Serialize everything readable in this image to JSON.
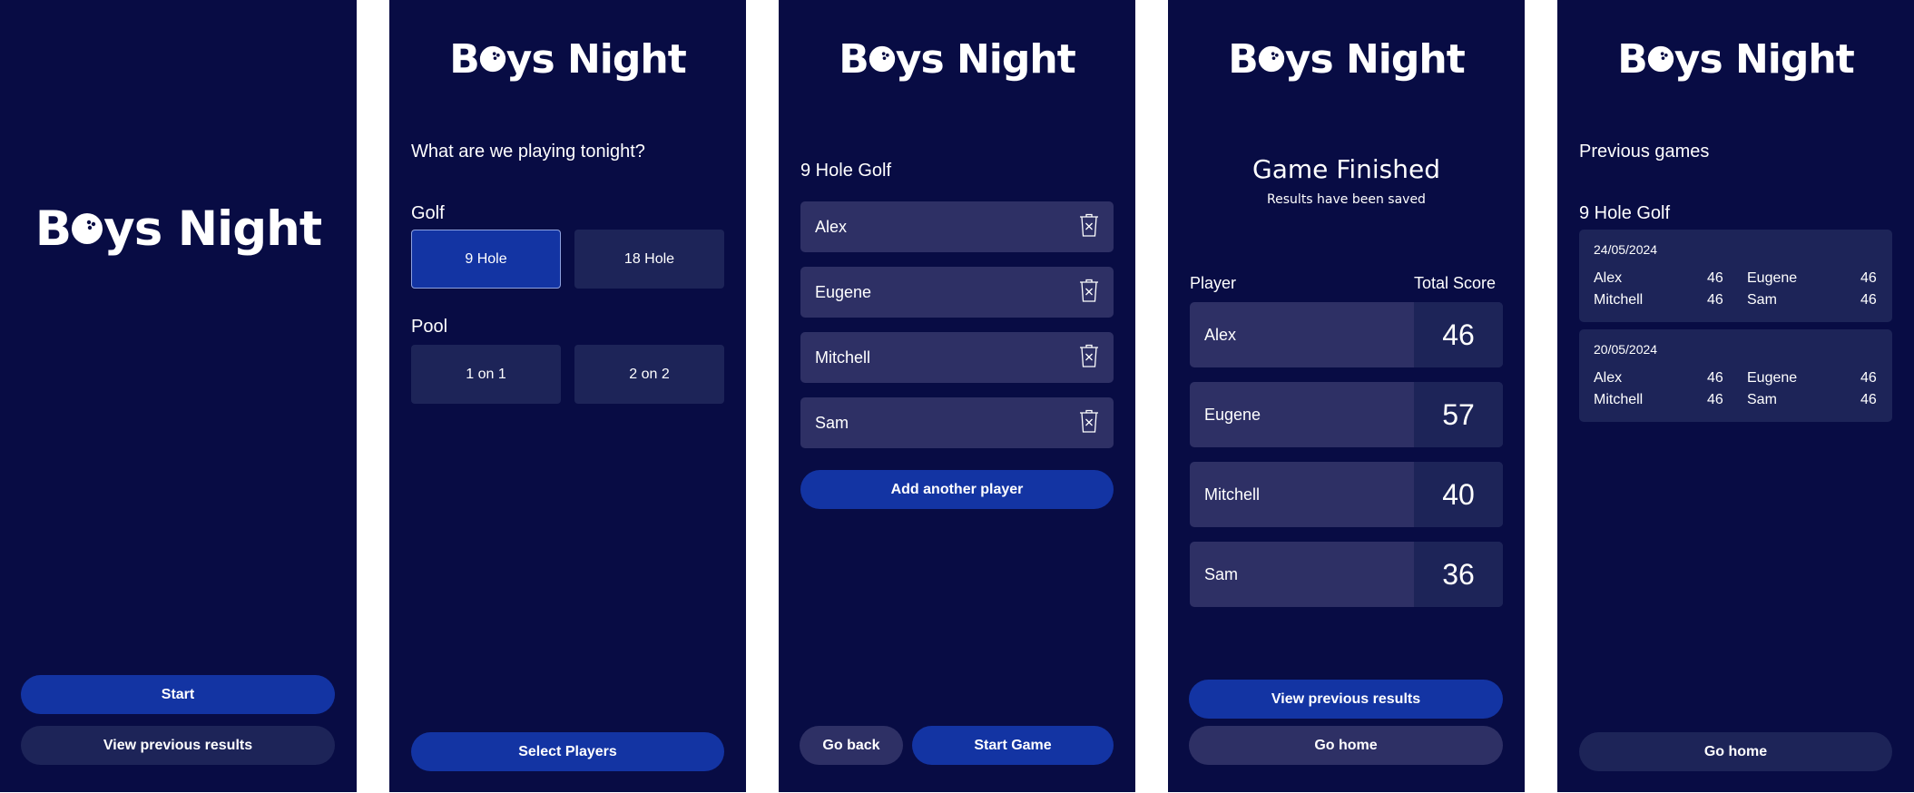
{
  "brand": {
    "name_pre": "B",
    "name_post": "ys Night"
  },
  "screen1": {
    "start_label": "Start",
    "view_label": "View previous results"
  },
  "screen2": {
    "question": "What are we playing tonight?",
    "golf_label": "Golf",
    "golf_options": [
      "9 Hole",
      "18 Hole"
    ],
    "golf_selected": "9 Hole",
    "pool_label": "Pool",
    "pool_options": [
      "1 on 1",
      "2 on 2"
    ],
    "select_label": "Select Players"
  },
  "screen3": {
    "game_title": "9 Hole Golf",
    "players": [
      "Alex",
      "Eugene",
      "Mitchell",
      "Sam"
    ],
    "add_label": "Add another player",
    "back_label": "Go back",
    "start_game_label": "Start Game"
  },
  "screen4": {
    "title": "Game Finished",
    "subtitle": "Results have been saved",
    "col_player": "Player",
    "col_score": "Total Score",
    "results": [
      {
        "name": "Alex",
        "score": "46"
      },
      {
        "name": "Eugene",
        "score": "57"
      },
      {
        "name": "Mitchell",
        "score": "40"
      },
      {
        "name": "Sam",
        "score": "36"
      }
    ],
    "view_label": "View previous results",
    "home_label": "Go home"
  },
  "screen5": {
    "title": "Previous games",
    "game_title": "9 Hole Golf",
    "games": [
      {
        "date": "24/05/2024",
        "scores": [
          {
            "name": "Alex",
            "score": "46"
          },
          {
            "name": "Eugene",
            "score": "46"
          },
          {
            "name": "Mitchell",
            "score": "46"
          },
          {
            "name": "Sam",
            "score": "46"
          }
        ]
      },
      {
        "date": "20/05/2024",
        "scores": [
          {
            "name": "Alex",
            "score": "46"
          },
          {
            "name": "Eugene",
            "score": "46"
          },
          {
            "name": "Mitchell",
            "score": "46"
          },
          {
            "name": "Sam",
            "score": "46"
          }
        ]
      }
    ],
    "home_label": "Go home"
  },
  "icons": {
    "bowling_ball": "bowling-ball-icon",
    "delete": "trash-icon"
  },
  "colors": {
    "background": "#080c44",
    "primary": "#1334a3",
    "secondary": "#1d2458",
    "tertiary": "#2e3065"
  }
}
